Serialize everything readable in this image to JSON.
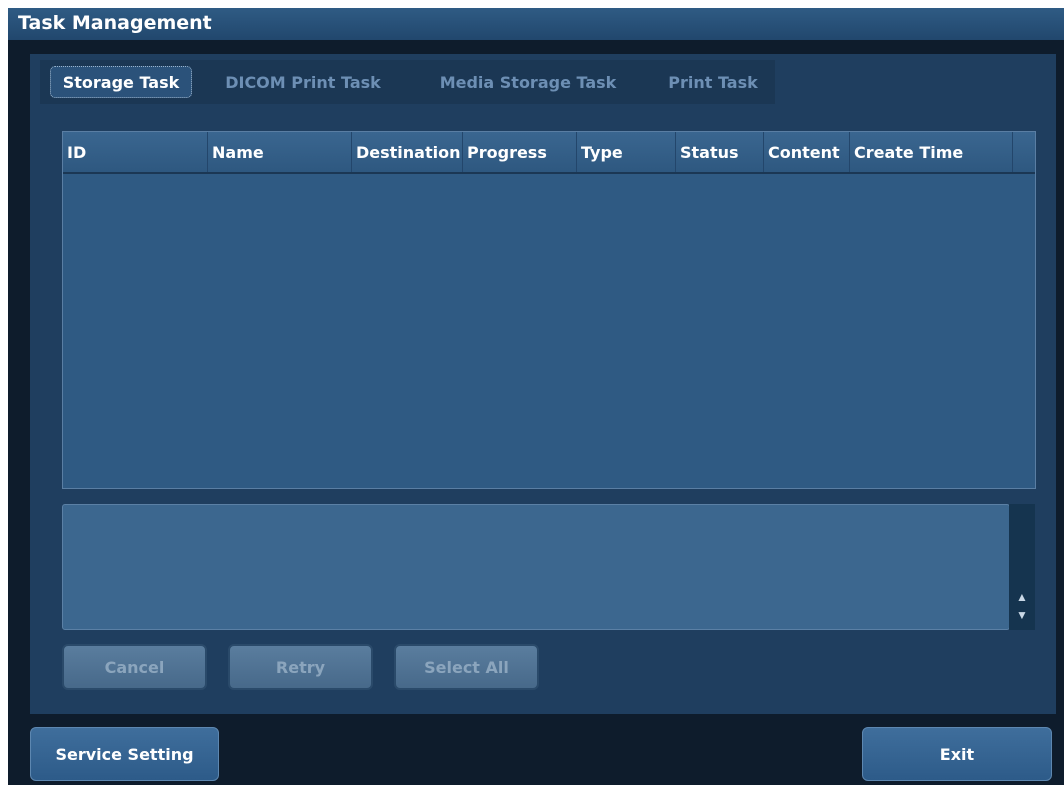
{
  "window": {
    "title": "Task Management"
  },
  "tabs": [
    {
      "label": "Storage Task",
      "active": true
    },
    {
      "label": "DICOM Print Task",
      "active": false
    },
    {
      "label": "Media Storage Task",
      "active": false
    },
    {
      "label": "Print Task",
      "active": false
    }
  ],
  "table": {
    "columns": [
      "ID",
      "Name",
      "Destination",
      "Progress",
      "Type",
      "Status",
      "Content",
      "Create Time"
    ],
    "rows": []
  },
  "message_box": {
    "text": ""
  },
  "actions": {
    "cancel_label": "Cancel",
    "retry_label": "Retry",
    "select_all_label": "Select All"
  },
  "footer": {
    "service_setting_label": "Service Setting",
    "exit_label": "Exit"
  },
  "icons": {
    "scroll_up": "arrow-up-icon",
    "scroll_down": "arrow-down-icon"
  }
}
